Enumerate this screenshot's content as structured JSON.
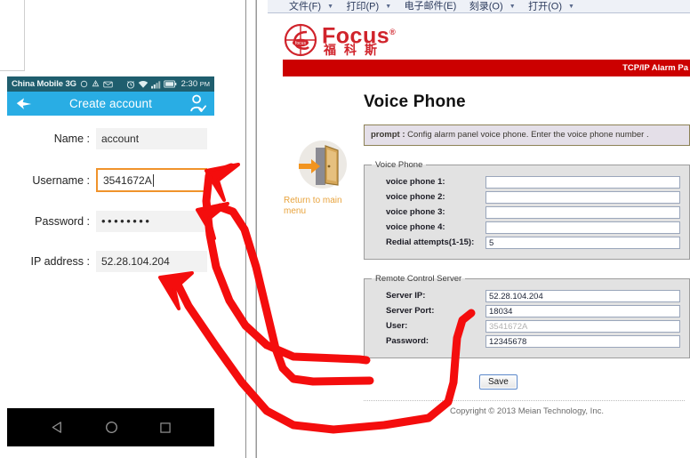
{
  "browser": {
    "menu": [
      {
        "label": "文件(F)",
        "caret": true
      },
      {
        "label": "打印(P)",
        "caret": true
      },
      {
        "label": "电子邮件(E)",
        "caret": false
      },
      {
        "label": "刻录(O)",
        "caret": true
      },
      {
        "label": "打开(O)",
        "caret": true
      }
    ],
    "logo": {
      "text": "Focus",
      "reg": "®",
      "chinese": "福科斯",
      "icon": "focus-target-logo"
    },
    "banner": "TCP/IP Alarm Pa",
    "sidebar": {
      "return_label": "Return to main menu",
      "icon": "open-door-exit-icon"
    },
    "page_title": "Voice Phone",
    "prompt_prefix": "prompt : ",
    "prompt_text": "Config alarm panel voice phone. Enter the voice phone number .",
    "voice_group": {
      "legend": "Voice Phone",
      "fields": [
        {
          "label": "voice phone 1:",
          "value": "",
          "readonly": false
        },
        {
          "label": "voice phone 2:",
          "value": "",
          "readonly": false
        },
        {
          "label": "voice phone 3:",
          "value": "",
          "readonly": false
        },
        {
          "label": "voice phone 4:",
          "value": "",
          "readonly": false
        },
        {
          "label": "Redial attempts(1-15):",
          "value": "5",
          "readonly": false
        }
      ]
    },
    "remote_group": {
      "legend": "Remote Control Server",
      "fields": [
        {
          "label": "Server IP:",
          "value": "52.28.104.204",
          "readonly": false
        },
        {
          "label": "Server Port:",
          "value": "18034",
          "readonly": false
        },
        {
          "label": "User:",
          "value": "3541672A",
          "readonly": true
        },
        {
          "label": "Password:",
          "value": "12345678",
          "readonly": false
        }
      ]
    },
    "save_label": "Save",
    "copyright": "Copyright © 2013 Meian Technology, Inc."
  },
  "phone": {
    "statusbar": {
      "carrier": "China Mobile 3G",
      "time": "2:30",
      "ampm": "PM",
      "left_icons": [
        "circle-icon",
        "sync-icon",
        "mail-icon"
      ],
      "right_icons": [
        "alarm-clock-icon",
        "wifi-icon",
        "signal-bars-icon",
        "battery-icon"
      ]
    },
    "appbar": {
      "back_icon": "back-arrow-icon",
      "title": "Create account",
      "confirm_icon": "person-check-icon"
    },
    "form": [
      {
        "label": "Name :",
        "value": "account",
        "type": "text",
        "focused": false
      },
      {
        "label": "Username :",
        "value": "3541672A",
        "type": "text",
        "focused": true
      },
      {
        "label": "Password :",
        "value": "••••••••",
        "type": "password",
        "focused": false
      },
      {
        "label": "IP address :",
        "value": "52.28.104.204",
        "type": "text",
        "focused": false
      }
    ],
    "navbar": {
      "back_icon": "nav-back-triangle-icon",
      "home_icon": "nav-home-circle-icon",
      "recents_icon": "nav-recents-square-icon"
    }
  },
  "annotations": {
    "color": "#f40d0d",
    "arrows": [
      {
        "name": "arrow-user-to-username",
        "from": "Remote Control Server User field",
        "to": "Username field"
      },
      {
        "name": "arrow-password-to-password",
        "from": "Remote Control Server Password field",
        "to": "Password field"
      },
      {
        "name": "arrow-serverip-to-ipaddress",
        "from": "Remote Control Server Server IP field",
        "to": "IP address field"
      }
    ]
  }
}
